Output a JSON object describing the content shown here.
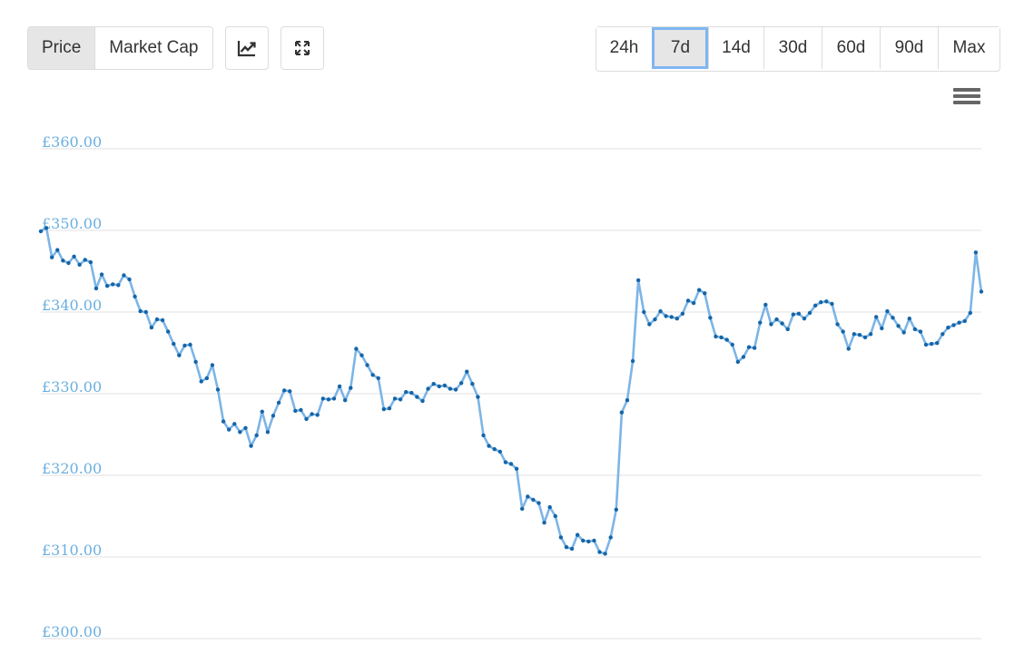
{
  "toolbar": {
    "metric_tabs": [
      {
        "label": "Price",
        "active": true
      },
      {
        "label": "Market Cap",
        "active": false
      }
    ],
    "icons": [
      "line-chart-icon",
      "expand-icon"
    ],
    "ranges": [
      {
        "label": "24h",
        "active": false
      },
      {
        "label": "7d",
        "active": true
      },
      {
        "label": "14d",
        "active": false
      },
      {
        "label": "30d",
        "active": false
      },
      {
        "label": "60d",
        "active": false
      },
      {
        "label": "90d",
        "active": false
      },
      {
        "label": "Max",
        "active": false
      }
    ],
    "menu_icon": "hamburger-menu-icon"
  },
  "colors": {
    "line": "#7db5e6",
    "point": "#1565a8",
    "grid": "#e0e0e0",
    "axis_label": "#6aafe0",
    "active_outline": "#7fb6f0"
  },
  "chart_data": {
    "type": "line",
    "ylim": [
      300,
      360
    ],
    "ytick_values": [
      300,
      310,
      320,
      330,
      340,
      350,
      360
    ],
    "ytick_labels": [
      "£300.00",
      "£310.00",
      "£320.00",
      "£330.00",
      "£340.00",
      "£350.00",
      "£360.00"
    ],
    "grid": true,
    "series": [
      {
        "values": [
          349.9,
          350.3,
          346.7,
          347.6,
          346.3,
          346.0,
          346.8,
          345.8,
          346.4,
          346.1,
          342.9,
          344.6,
          343.2,
          343.4,
          343.3,
          344.5,
          344.0,
          341.9,
          340.1,
          340.0,
          338.1,
          339.1,
          339.0,
          337.6,
          336.1,
          334.7,
          335.9,
          336.0,
          333.9,
          331.5,
          331.9,
          333.5,
          330.5,
          326.6,
          325.6,
          326.3,
          325.3,
          325.8,
          323.6,
          324.9,
          327.8,
          325.3,
          327.3,
          328.9,
          330.4,
          330.3,
          327.9,
          328.0,
          326.9,
          327.5,
          327.4,
          329.4,
          329.3,
          329.4,
          330.9,
          329.2,
          330.7,
          335.5,
          334.7,
          333.5,
          332.3,
          331.9,
          328.1,
          328.2,
          329.4,
          329.3,
          330.2,
          330.1,
          329.6,
          329.1,
          330.6,
          331.2,
          330.9,
          331.0,
          330.6,
          330.5,
          331.3,
          332.7,
          331.2,
          329.6,
          324.9,
          323.6,
          323.2,
          322.9,
          321.6,
          321.4,
          320.8,
          315.9,
          317.4,
          317.0,
          316.6,
          314.2,
          316.1,
          315.0,
          312.4,
          311.2,
          311.0,
          312.7,
          312.0,
          311.9,
          312.0,
          310.6,
          310.4,
          312.4,
          315.8,
          327.7,
          329.2,
          334.0,
          343.9,
          340.0,
          338.5,
          339.1,
          340.1,
          339.5,
          339.4,
          339.2,
          339.8,
          341.4,
          341.1,
          342.7,
          342.3,
          339.3,
          337.0,
          336.9,
          336.6,
          336.0,
          333.9,
          334.5,
          335.7,
          335.6,
          338.7,
          340.9,
          338.5,
          339.1,
          338.6,
          337.9,
          339.7,
          339.8,
          339.2,
          339.9,
          340.8,
          341.2,
          341.3,
          341.0,
          338.5,
          337.6,
          335.5,
          337.3,
          337.2,
          336.9,
          337.3,
          339.4,
          338.0,
          340.1,
          339.3,
          338.3,
          337.5,
          339.2,
          337.9,
          337.6,
          336.0,
          336.1,
          336.2,
          337.3,
          338.1,
          338.4,
          338.7,
          338.9,
          339.9,
          347.3,
          342.5
        ]
      }
    ]
  }
}
